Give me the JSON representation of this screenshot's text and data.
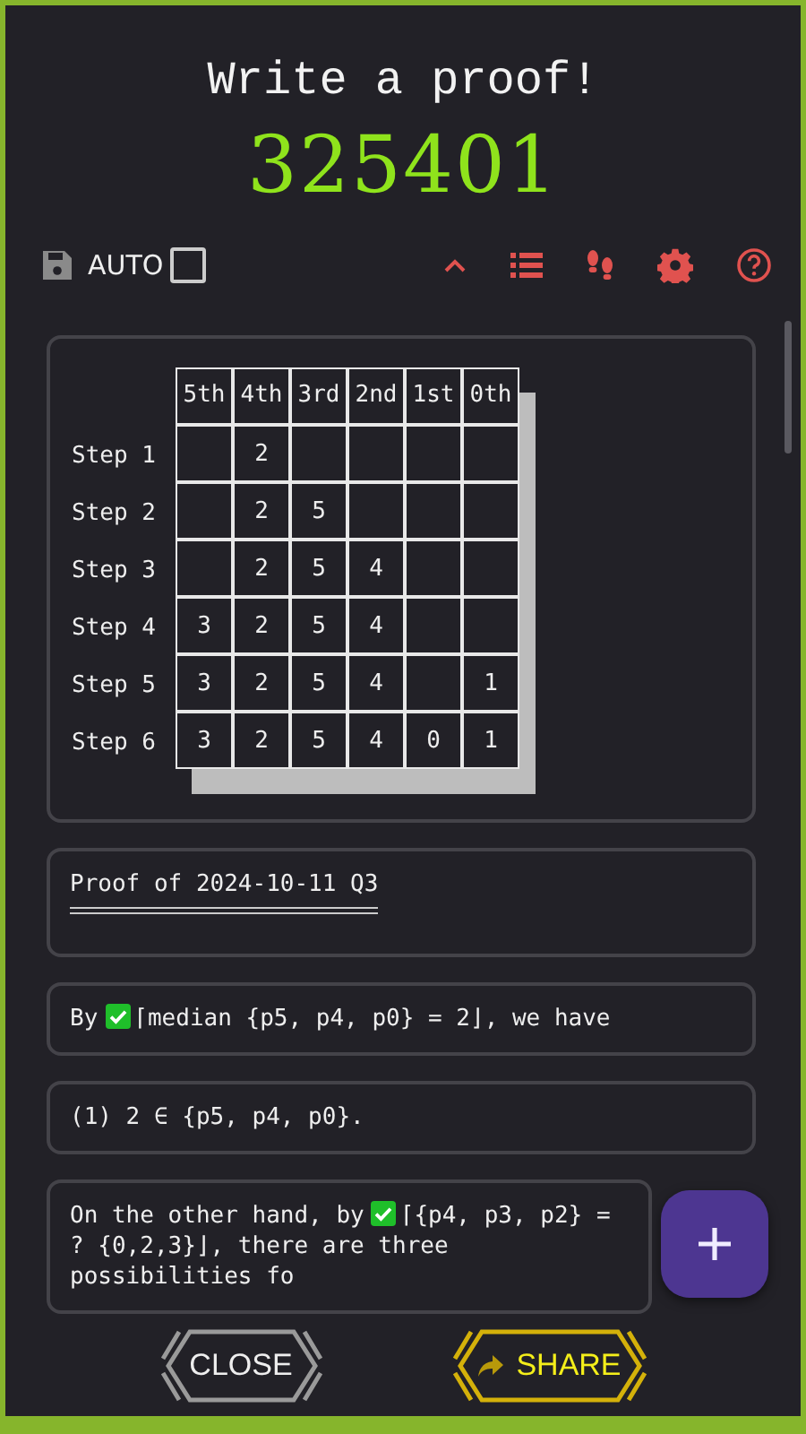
{
  "header": {
    "title": "Write a proof!",
    "puzzle": "325401"
  },
  "toolbar": {
    "auto_label": "AUTO",
    "auto_checked": false
  },
  "table": {
    "columns": [
      "5th",
      "4th",
      "3rd",
      "2nd",
      "1st",
      "0th"
    ],
    "rows": [
      {
        "label": "Step 1",
        "cells": [
          null,
          "2",
          null,
          null,
          null,
          null
        ]
      },
      {
        "label": "Step 2",
        "cells": [
          null,
          "2",
          "5",
          null,
          null,
          null
        ]
      },
      {
        "label": "Step 3",
        "cells": [
          null,
          "2",
          "5",
          "4",
          null,
          null
        ]
      },
      {
        "label": "Step 4",
        "cells": [
          "3",
          "2",
          "5",
          "4",
          null,
          null
        ]
      },
      {
        "label": "Step 5",
        "cells": [
          "3",
          "2",
          "5",
          "4",
          null,
          "1"
        ]
      },
      {
        "label": "Step 6",
        "cells": [
          "3",
          "2",
          "5",
          "4",
          "0",
          "1"
        ]
      }
    ]
  },
  "blocks": [
    {
      "kind": "heading",
      "text": "Proof of 2024-10-11 Q3"
    },
    {
      "kind": "cited",
      "lead": "By",
      "verified": true,
      "text": "⌈median {p5, p4, p0} = 2⌋, we have"
    },
    {
      "kind": "plain",
      "text": "(1) 2 ∈ {p5, p4, p0}."
    },
    {
      "kind": "cited",
      "lead": "On the other hand, by",
      "verified": true,
      "text": "⌈{p4, p3, p2} = ? {0,2,3}⌋, there are three possibilities fo"
    }
  ],
  "buttons": [
    {
      "kind": "close",
      "label": "CLOSE"
    },
    {
      "kind": "share",
      "label": "SHARE"
    }
  ]
}
